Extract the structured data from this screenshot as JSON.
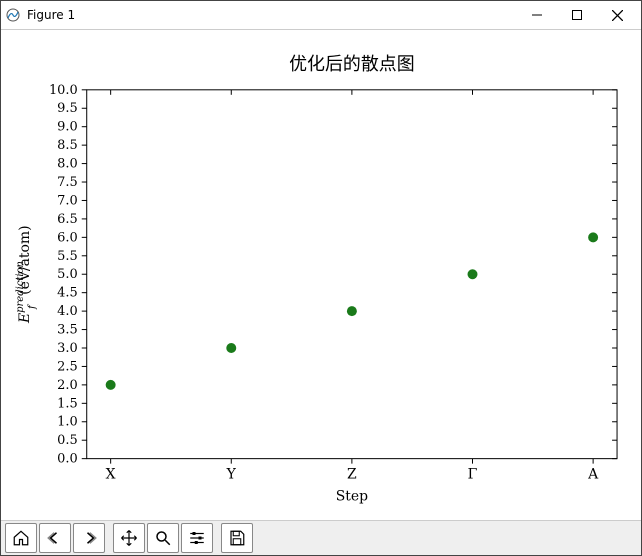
{
  "window": {
    "title": "Figure 1"
  },
  "toolbar": {
    "home": "home-icon",
    "back": "back-icon",
    "forward": "forward-icon",
    "pan": "move-icon",
    "zoom": "zoom-icon",
    "subplots": "sliders-icon",
    "save": "save-icon"
  },
  "chart_data": {
    "type": "scatter",
    "title": "优化后的散点图",
    "xlabel": "Step",
    "ylabel_html": "<tspan font-style='italic'>E</tspan><tspan font-style='italic' baseline-shift='super' font-size='10'>prediction</tspan><tspan font-style='italic' baseline-shift='sub' font-size='10' dx='-47'>f</tspan><tspan dx='40'> (eV/atom)</tspan>",
    "ylabel_plain": "E_f^{prediction} (eV/atom)",
    "categories": [
      "X",
      "Y",
      "Z",
      "Γ",
      "A"
    ],
    "values": [
      2.0,
      3.0,
      4.0,
      5.0,
      6.0
    ],
    "y_ticks": [
      0.0,
      0.5,
      1.0,
      1.5,
      2.0,
      2.5,
      3.0,
      3.5,
      4.0,
      4.5,
      5.0,
      5.5,
      6.0,
      6.5,
      7.0,
      7.5,
      8.0,
      8.5,
      9.0,
      9.5,
      10.0
    ],
    "ylim": [
      0.0,
      10.0
    ],
    "marker_color": "#1a7a1a"
  }
}
